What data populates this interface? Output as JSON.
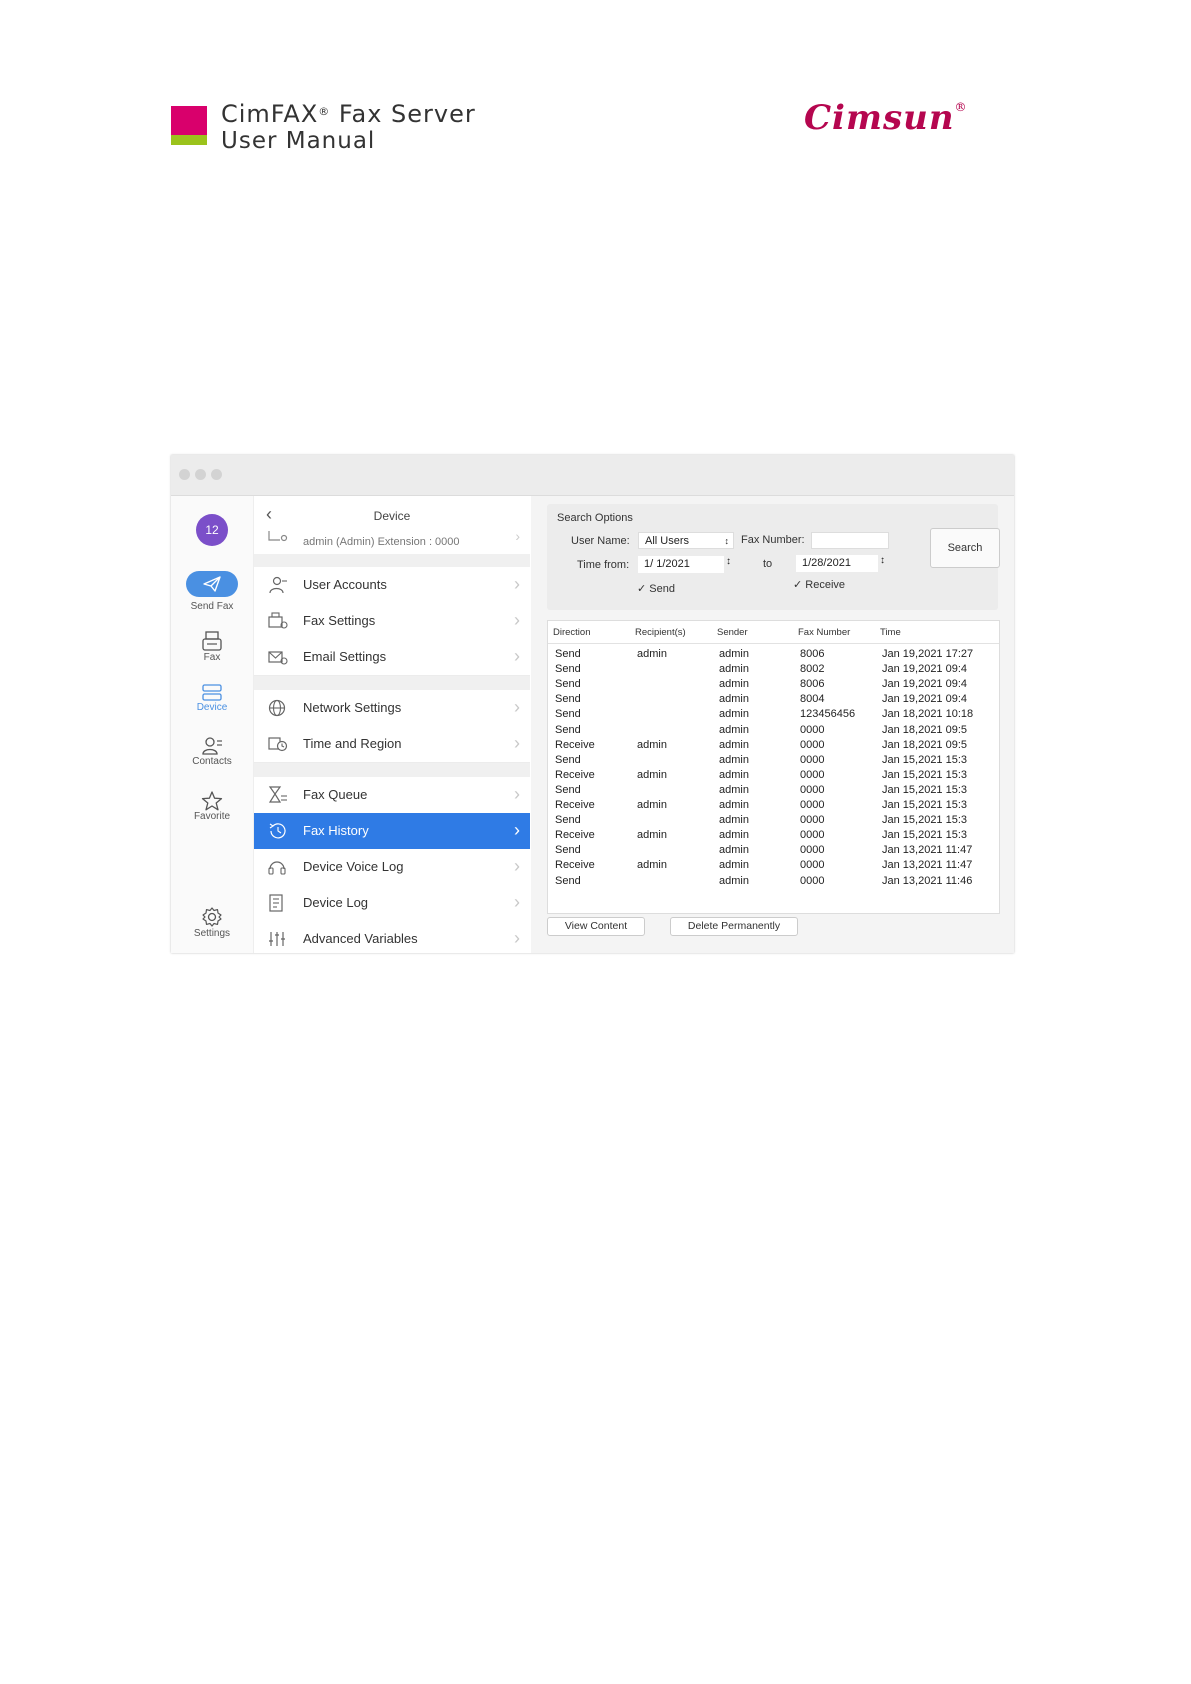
{
  "doc": {
    "title_line1": "CimFAX",
    "title_reg": "®",
    "title_line1_rest": " Fax Server",
    "title_line2": "User Manual",
    "brand": "Cimsun",
    "brand_reg": "®",
    "colors": {
      "magenta": "#d9006c",
      "green": "#9bc31c",
      "brand": "#b5064f"
    }
  },
  "rail": {
    "badge": "12",
    "items": [
      {
        "label": "Send Fax",
        "icon": "paper-plane-icon"
      },
      {
        "label": "Fax",
        "icon": "fax-machine-icon"
      },
      {
        "label": "Device",
        "icon": "server-icon",
        "active": true
      },
      {
        "label": "Contacts",
        "icon": "contacts-icon"
      },
      {
        "label": "Favorite",
        "icon": "star-icon"
      },
      {
        "label": "Settings",
        "icon": "gear-icon"
      }
    ]
  },
  "menu": {
    "title": "Device",
    "admin_line": "admin (Admin)   Extension : 0000",
    "items": [
      {
        "label": "User Accounts",
        "icon": "users-icon"
      },
      {
        "label": "Fax Settings",
        "icon": "fax-settings-icon"
      },
      {
        "label": "Email Settings",
        "icon": "email-settings-icon"
      },
      {
        "label": "Network Settings",
        "icon": "globe-icon"
      },
      {
        "label": "Time and Region",
        "icon": "clock-icon"
      },
      {
        "label": "Fax Queue",
        "icon": "hourglass-icon"
      },
      {
        "label": "Fax History",
        "icon": "history-icon",
        "selected": true
      },
      {
        "label": "Device Voice Log",
        "icon": "headset-icon"
      },
      {
        "label": "Device Log",
        "icon": "log-icon"
      },
      {
        "label": "Advanced Variables",
        "icon": "sliders-icon"
      }
    ]
  },
  "search": {
    "title": "Search Options",
    "user_name_label": "User Name:",
    "user_name_value": "All Users",
    "fax_number_label": "Fax Number:",
    "fax_number_value": "",
    "time_from_label": "Time from:",
    "time_from_value": "1/  1/2021",
    "to_label": "to",
    "time_to_value": "1/28/2021",
    "search_button": "Search",
    "send_label": "Send",
    "send_checked": true,
    "receive_label": "Receive",
    "receive_checked": true
  },
  "table": {
    "columns": [
      "Direction",
      "Recipient(s)",
      "Sender",
      "Fax Number",
      "Time"
    ],
    "rows": [
      [
        "Send",
        "admin",
        "admin",
        "8006",
        "Jan 19,2021 17:27"
      ],
      [
        "Send",
        "",
        "admin",
        "8002",
        "Jan 19,2021 09:4"
      ],
      [
        "Send",
        "",
        "admin",
        "8006",
        "Jan 19,2021 09:4"
      ],
      [
        "Send",
        "",
        "admin",
        "8004",
        "Jan 19,2021 09:4"
      ],
      [
        "Send",
        "",
        "admin",
        "123456456",
        "Jan 18,2021 10:18"
      ],
      [
        "Send",
        "",
        "admin",
        "0000",
        "Jan 18,2021 09:5"
      ],
      [
        "Receive",
        "admin",
        "admin",
        "0000",
        "Jan 18,2021 09:5"
      ],
      [
        "Send",
        "",
        "admin",
        "0000",
        "Jan 15,2021 15:3"
      ],
      [
        "Receive",
        "admin",
        "admin",
        "0000",
        "Jan 15,2021 15:3"
      ],
      [
        "Send",
        "",
        "admin",
        "0000",
        "Jan 15,2021 15:3"
      ],
      [
        "Receive",
        "admin",
        "admin",
        "0000",
        "Jan 15,2021 15:3"
      ],
      [
        "Send",
        "",
        "admin",
        "0000",
        "Jan 15,2021 15:3"
      ],
      [
        "Receive",
        "admin",
        "admin",
        "0000",
        "Jan 15,2021 15:3"
      ],
      [
        "Send",
        "",
        "admin",
        "0000",
        "Jan 13,2021 11:47"
      ],
      [
        "Receive",
        "admin",
        "admin",
        "0000",
        "Jan 13,2021 11:47"
      ],
      [
        "Send",
        "",
        "admin",
        "0000",
        "Jan 13,2021 11:46"
      ]
    ]
  },
  "actions": {
    "view_content": "View Content",
    "delete_permanently": "Delete Permanently"
  }
}
